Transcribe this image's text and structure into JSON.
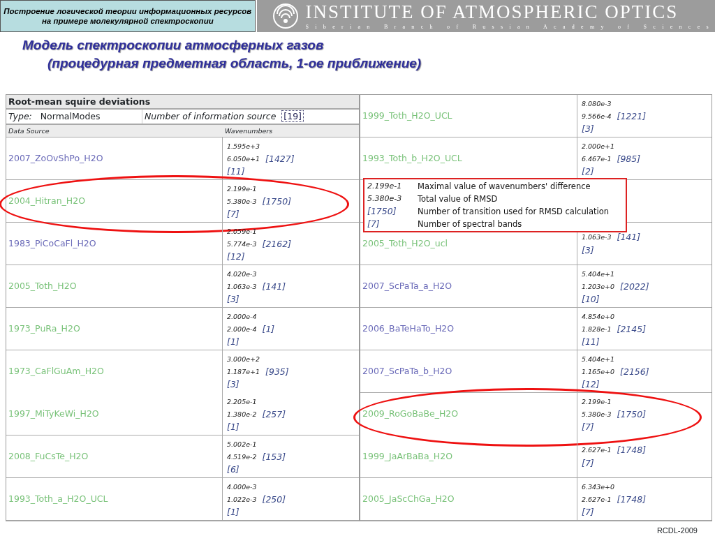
{
  "header": {
    "topic": [
      "Построение логической теории информационных ресурсов",
      "на примере молекулярной спектроскопии"
    ],
    "institute": "INSTITUTE OF ATMOSPHERIC OPTICS",
    "branch": "Siberian Branch of Russian Academy of Sciences"
  },
  "title": [
    "Модель спектроскопии атмосферных газов",
    "(процедурная предметная область, 1-ое приближение)"
  ],
  "left_table": {
    "title": "Root-mean squire deviations",
    "type_label": "Type:",
    "type_value": "NormalModes",
    "sources_label": "Number of information source",
    "sources_count": "[19]",
    "columns": [
      "Data Source",
      "Wavenumbers"
    ],
    "rows": [
      {
        "source": "2007_ZoOvShPo_H2O",
        "visited": false,
        "max": "1.595e+3",
        "rmsd": "6.050e+1",
        "transitions": "[1427]",
        "bands": "[11]",
        "highlighted": false,
        "divider": true
      },
      {
        "source": "2004_Hitran_H2O",
        "visited": true,
        "max": "2.199e-1",
        "rmsd": "5.380e-3",
        "transitions": "[1750]",
        "bands": "[7]",
        "highlighted": true,
        "divider": true
      },
      {
        "source": "1983_PiCoCaFl_H2O",
        "visited": false,
        "max": "2.059e-1",
        "rmsd": "5.774e-3",
        "transitions": "[2162]",
        "bands": "[12]",
        "highlighted": false,
        "divider": true
      },
      {
        "source": "2005_Toth_H2O",
        "visited": true,
        "max": "4.020e-3",
        "rmsd": "1.063e-3",
        "transitions": "[141]",
        "bands": "[3]",
        "highlighted": false,
        "divider": true
      },
      {
        "source": "1973_PuRa_H2O",
        "visited": true,
        "max": "2.000e-4",
        "rmsd": "2.000e-4",
        "transitions": "[1]",
        "bands": "[1]",
        "highlighted": false,
        "divider": true
      },
      {
        "source": "1973_CaFlGuAm_H2O",
        "visited": true,
        "max": "3.000e+2",
        "rmsd": "1.187e+1",
        "transitions": "[935]",
        "bands": "[3]",
        "highlighted": false,
        "divider": false
      },
      {
        "source": "1997_MiTyKeWi_H2O",
        "visited": true,
        "max": "2.205e-1",
        "rmsd": "1.380e-2",
        "transitions": "[257]",
        "bands": "[1]",
        "highlighted": false,
        "divider": true
      },
      {
        "source": "2008_FuCsTe_H2O",
        "visited": true,
        "max": "5.002e-1",
        "rmsd": "4.519e-2",
        "transitions": "[153]",
        "bands": "[6]",
        "highlighted": false,
        "divider": true
      },
      {
        "source": "1993_Toth_a_H2O_UCL",
        "visited": true,
        "max": "4.000e-3",
        "rmsd": "1.022e-3",
        "transitions": "[250]",
        "bands": "[1]",
        "highlighted": false,
        "divider": true
      }
    ]
  },
  "right_table": {
    "rows": [
      {
        "source": "1999_Toth_H2O_UCL",
        "visited": true,
        "max": "8.080e-3",
        "rmsd": "9.566e-4",
        "transitions": "[1221]",
        "bands": "[3]",
        "highlighted": false,
        "divider": true
      },
      {
        "source": "1993_Toth_b_H2O_UCL",
        "visited": true,
        "max": "2.000e+1",
        "rmsd": "6.467e-1",
        "transitions": "[985]",
        "bands": "[2]",
        "highlighted": false,
        "divider": true
      },
      {
        "highlighted": false,
        "divider": true
      },
      {
        "source": "2005_Toth_H2O_ucl",
        "visited": true,
        "rmsd": "1.063e-3",
        "transitions": "[141]",
        "bands": "[3]",
        "highlighted": false,
        "divider": true
      },
      {
        "source": "2007_ScPaTa_a_H2O",
        "visited": false,
        "max": "5.404e+1",
        "rmsd": "1.203e+0",
        "transitions": "[2022]",
        "bands": "[10]",
        "highlighted": false,
        "divider": true
      },
      {
        "source": "2006_BaTeHaTo_H2O",
        "visited": false,
        "max": "4.854e+0",
        "rmsd": "1.828e-1",
        "transitions": "[2145]",
        "bands": "[11]",
        "highlighted": false,
        "divider": true
      },
      {
        "source": "2007_ScPaTa_b_H2O",
        "visited": false,
        "max": "5.404e+1",
        "rmsd": "1.165e+0",
        "transitions": "[2156]",
        "bands": "[12]",
        "highlighted": false,
        "divider": true
      },
      {
        "source": "2009_RoGoBaBe_H2O",
        "visited": true,
        "max": "2.199e-1",
        "rmsd": "5.380e-3",
        "transitions": "[1750]",
        "bands": "[7]",
        "highlighted": true,
        "divider": false
      },
      {
        "source": "1999_JaArBaBa_H2O",
        "visited": true,
        "rmsd": "2.627e-1",
        "transitions": "[1748]",
        "bands": "[7]",
        "highlighted": false,
        "divider": true
      },
      {
        "source": "2005_JaScChGa_H2O",
        "visited": true,
        "max": "6.343e+0",
        "rmsd": "2.627e-1",
        "transitions": "[1748]",
        "bands": "[7]",
        "highlighted": false,
        "divider": true
      }
    ]
  },
  "legend": [
    {
      "kind": "number",
      "value": "2.199e-1",
      "text": "Maximal value of wavenumbers' difference"
    },
    {
      "kind": "number",
      "value": "5.380e-3",
      "text": "Total value of RMSD"
    },
    {
      "kind": "bracket",
      "value": "[1750]",
      "text": "Number of transition used for RMSD calculation"
    },
    {
      "kind": "bracket",
      "value": "[7]",
      "text": "Number of spectral bands"
    }
  ],
  "footer": "RCDL-2009"
}
